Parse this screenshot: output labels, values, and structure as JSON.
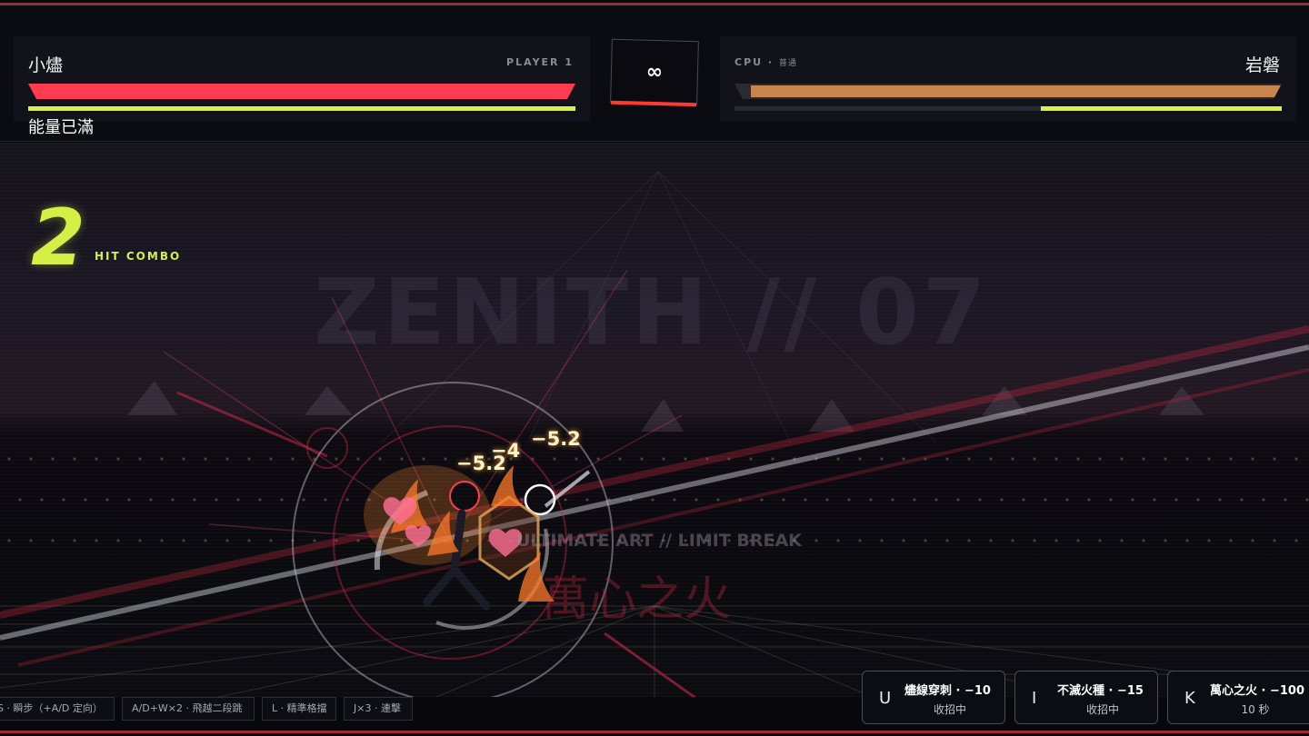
{
  "player1": {
    "name": "小燼",
    "tag": "PLAYER 1",
    "hp_fraction": 1.0,
    "energy_fraction": 1.0,
    "energy_label": "能量已滿",
    "hp_color": "#ff3b52",
    "energy_color": "#d8f04a"
  },
  "timer": {
    "value": "∞"
  },
  "player2": {
    "name": "岩磐",
    "tag": "CPU",
    "difficulty": "普通",
    "hp_fraction": 0.97,
    "energy_fraction": 0.44,
    "hp_color": "#c8844a"
  },
  "arena": {
    "stage_title": "ZENITH // 07",
    "ultimate_art_label": "ULTIMATE ART // LIMIT BREAK",
    "ultimate_name": "萬心之火"
  },
  "combo": {
    "count": "2",
    "label": "HIT COMBO"
  },
  "damage_numbers": [
    "−5.2",
    "−4",
    "−5.2"
  ],
  "controls_hints": [
    "S · 瞬步（+A/D 定向）",
    "A/D+W×2 · 飛越二段跳",
    "L · 精準格擋",
    "J×3 · 連擊"
  ],
  "skills": [
    {
      "key": "U",
      "name": "燼線穿刺 · −10",
      "status": "收招中"
    },
    {
      "key": "I",
      "name": "不滅火種 · −15",
      "status": "收招中"
    },
    {
      "key": "K",
      "name": "萬心之火 · −100",
      "status": "10 秒"
    }
  ]
}
